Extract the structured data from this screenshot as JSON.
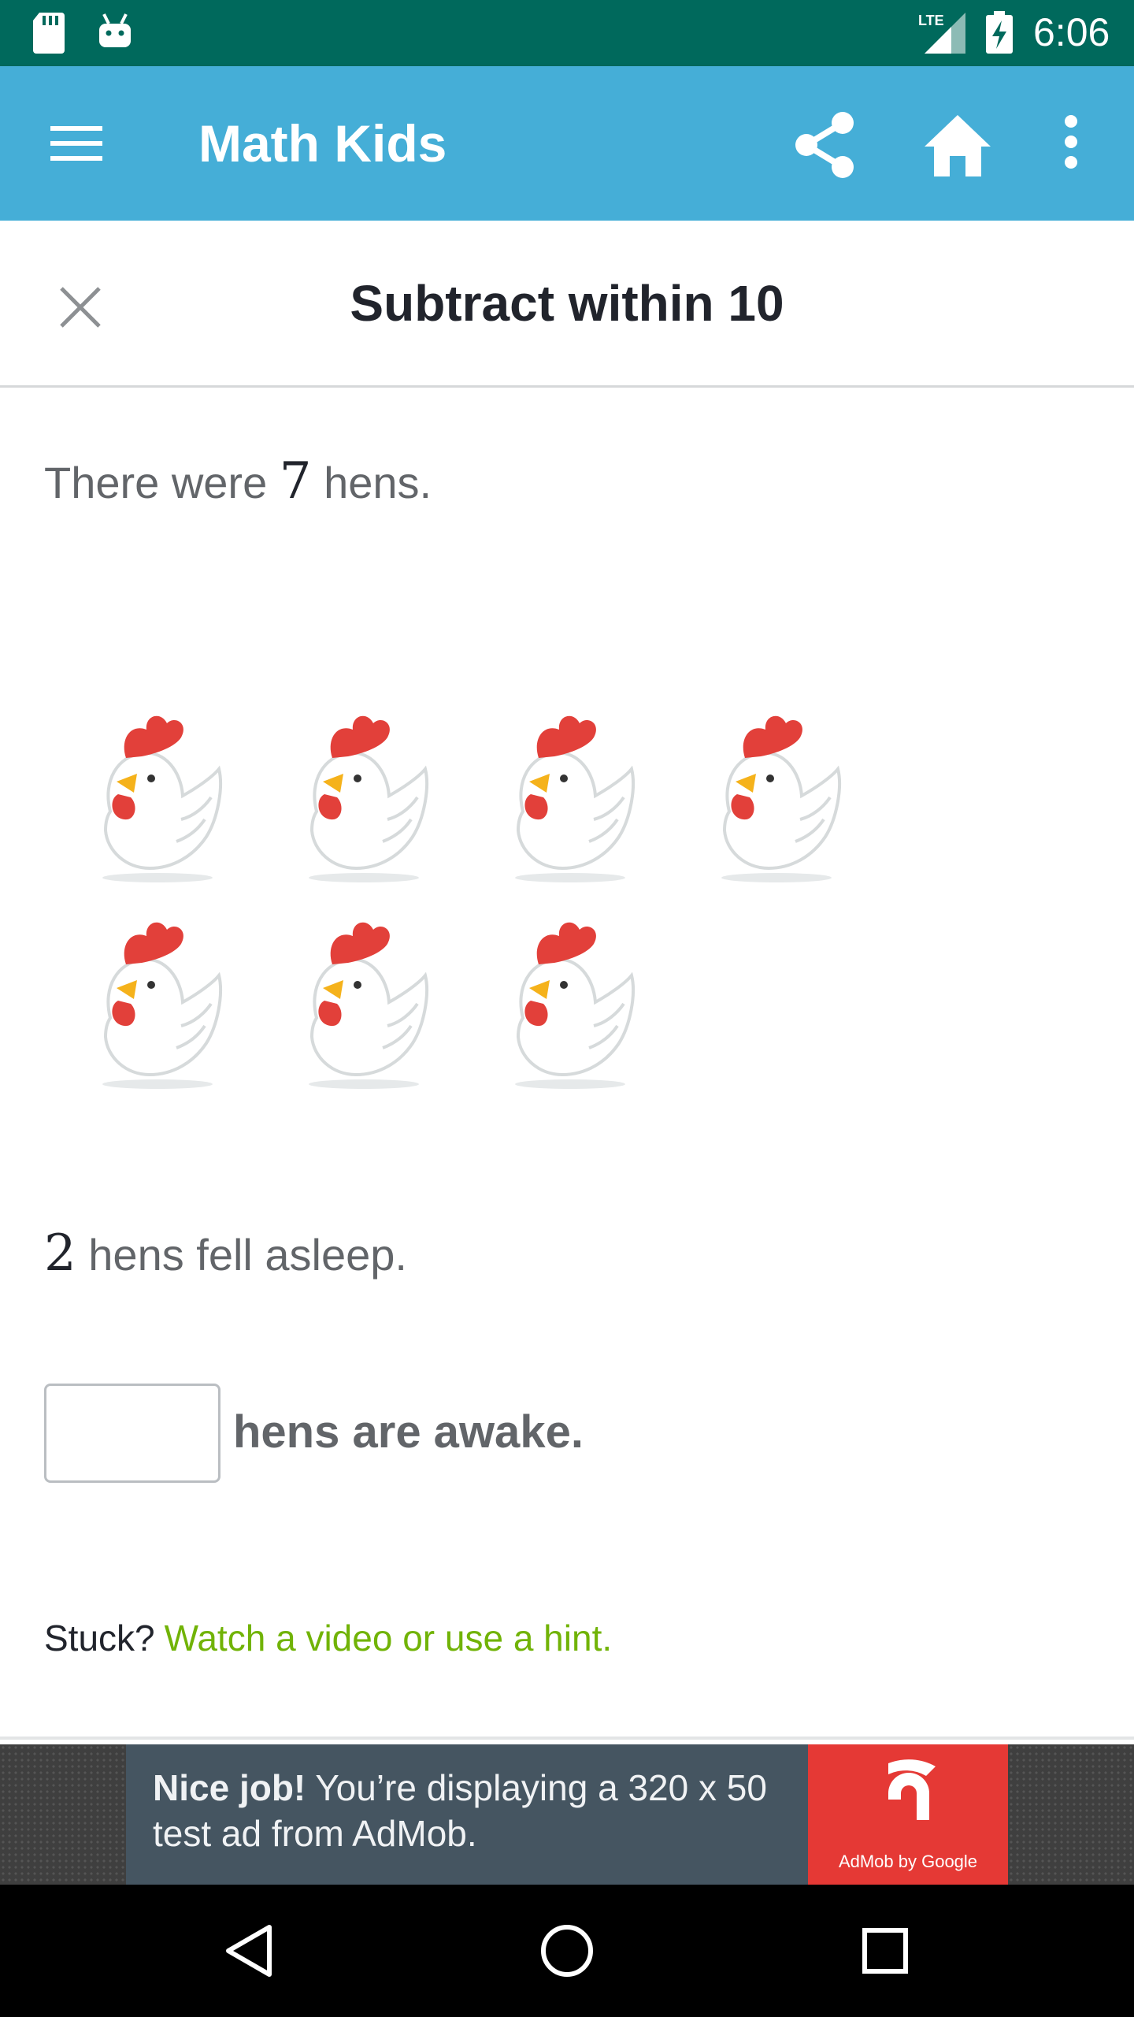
{
  "status_bar": {
    "time": "6:06",
    "network": "LTE",
    "icons": [
      "sd-card-icon",
      "android-icon",
      "signal-icon",
      "battery-charging-icon"
    ]
  },
  "app_bar": {
    "title": "Math Kids",
    "color": "#45aed7",
    "icons": [
      "menu-icon",
      "share-icon",
      "home-icon",
      "more-vert-icon"
    ]
  },
  "exercise": {
    "title": "Subtract within 10",
    "close_icon": "close-icon"
  },
  "question": {
    "line1_prefix": "There were ",
    "line1_number": "7",
    "line1_suffix": " hens.",
    "hen_count": 7,
    "hen_icon": "hen-icon",
    "line2_number": "2",
    "line2_suffix": " hens fell asleep.",
    "answer_value": "",
    "answer_label": "hens are awake."
  },
  "help": {
    "stuck_text": "Stuck?",
    "link_text": "Watch a video or use a hint.",
    "link_color": "#71b307"
  },
  "ad": {
    "bold_text": "Nice job!",
    "body_text": " You’re displaying a 320 x 50 test ad from AdMob.",
    "logo_caption": "AdMob by Google",
    "logo_color": "#e53935"
  },
  "nav_bar": {
    "icons": [
      "back-icon",
      "home-circle-icon",
      "recents-icon"
    ]
  }
}
